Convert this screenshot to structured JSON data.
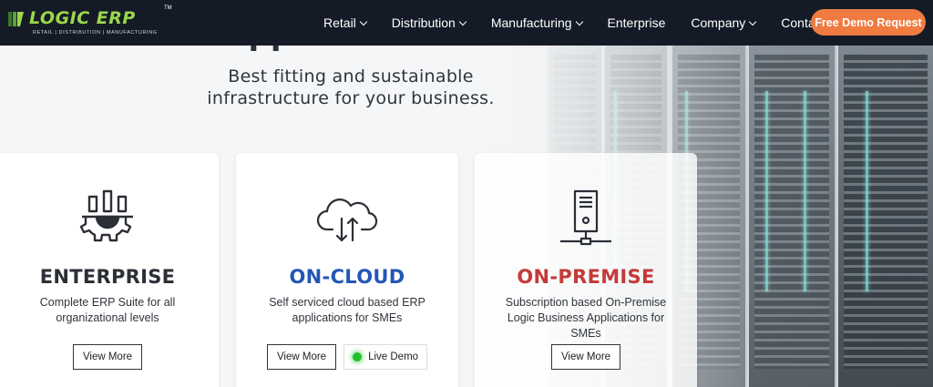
{
  "brand": {
    "name": "LOGIC ERP",
    "trademark": "TM",
    "tagline": "RETAIL | DISTRIBUTION | MANUFACTURING",
    "logo_color": "#9bd84a"
  },
  "nav": {
    "items": [
      {
        "label": "Retail",
        "has_dropdown": true
      },
      {
        "label": "Distribution",
        "has_dropdown": true
      },
      {
        "label": "Manufacturing",
        "has_dropdown": true
      },
      {
        "label": "Enterprise",
        "has_dropdown": false
      },
      {
        "label": "Company",
        "has_dropdown": true
      },
      {
        "label": "Contact us",
        "has_dropdown": false
      }
    ],
    "cta_label": "Free Demo Request",
    "cta_color": "#f07b40"
  },
  "hero": {
    "title_partial": "ERP Applications Platforms",
    "subtitle_line1": "Best fitting and sustainable",
    "subtitle_line2": "infrastructure for your business."
  },
  "cards": [
    {
      "icon": "enterprise-gear-icon",
      "title": "ENTERPRISE",
      "title_color": "#2b2f36",
      "desc_line1": "Complete ERP Suite for all",
      "desc_line2": "organizational levels",
      "button_label": "View More"
    },
    {
      "icon": "cloud-upload-download-icon",
      "title": "ON-CLOUD",
      "title_color": "#2356b5",
      "desc_line1": "Self serviced cloud based ERP",
      "desc_line2": "applications for SMEs",
      "button_label": "View More",
      "live_label": "Live Demo"
    },
    {
      "icon": "server-network-icon",
      "title": "ON-PREMISE",
      "title_color": "#c43a3a",
      "desc_line1": "Subscription based On-Premise",
      "desc_line2": "Logic Business Applications for SMEs",
      "button_label": "View More"
    }
  ]
}
